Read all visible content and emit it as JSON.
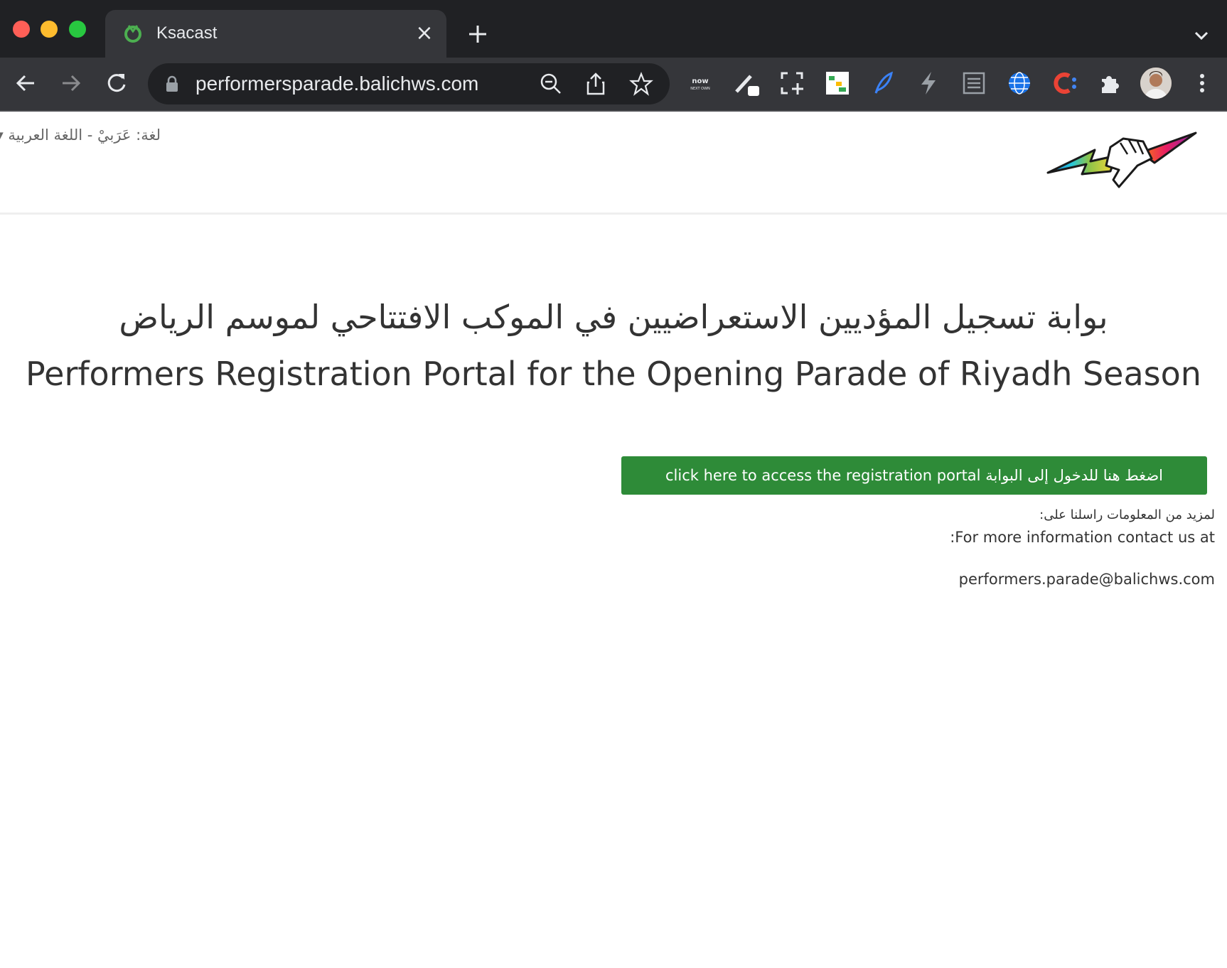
{
  "browser": {
    "tab_title": "Ksacast",
    "url": "performersparade.balichws.com",
    "extensions": [
      "now-next-icon",
      "pen-icon",
      "screenshot-icon",
      "sheets-icon",
      "feather-icon",
      "bolt-icon",
      "reader-icon",
      "globe-icon",
      "c-logo-icon",
      "puzzle-icon"
    ]
  },
  "header": {
    "language_label": "لغة: عَرَبيْ - اللغة العربية ▾"
  },
  "main": {
    "title_ar": "بوابة تسجيل المؤديين الاستعراضيين في الموكب الافتتاحي لموسم الرياض",
    "title_en": "Performers Registration Portal for the Opening Parade of Riyadh Season",
    "cta_label": "click here to access the registration portal اضغط هنا للدخول إلى البوابة",
    "info_ar": ":لمزيد من المعلومات راسلنا على",
    "info_en": ":For more information contact us at",
    "email": "performers.parade@balichws.com"
  },
  "colors": {
    "chrome_dark": "#202124",
    "chrome_toolbar": "#35363a",
    "cta_green": "#2e8b38",
    "text": "#333333"
  }
}
